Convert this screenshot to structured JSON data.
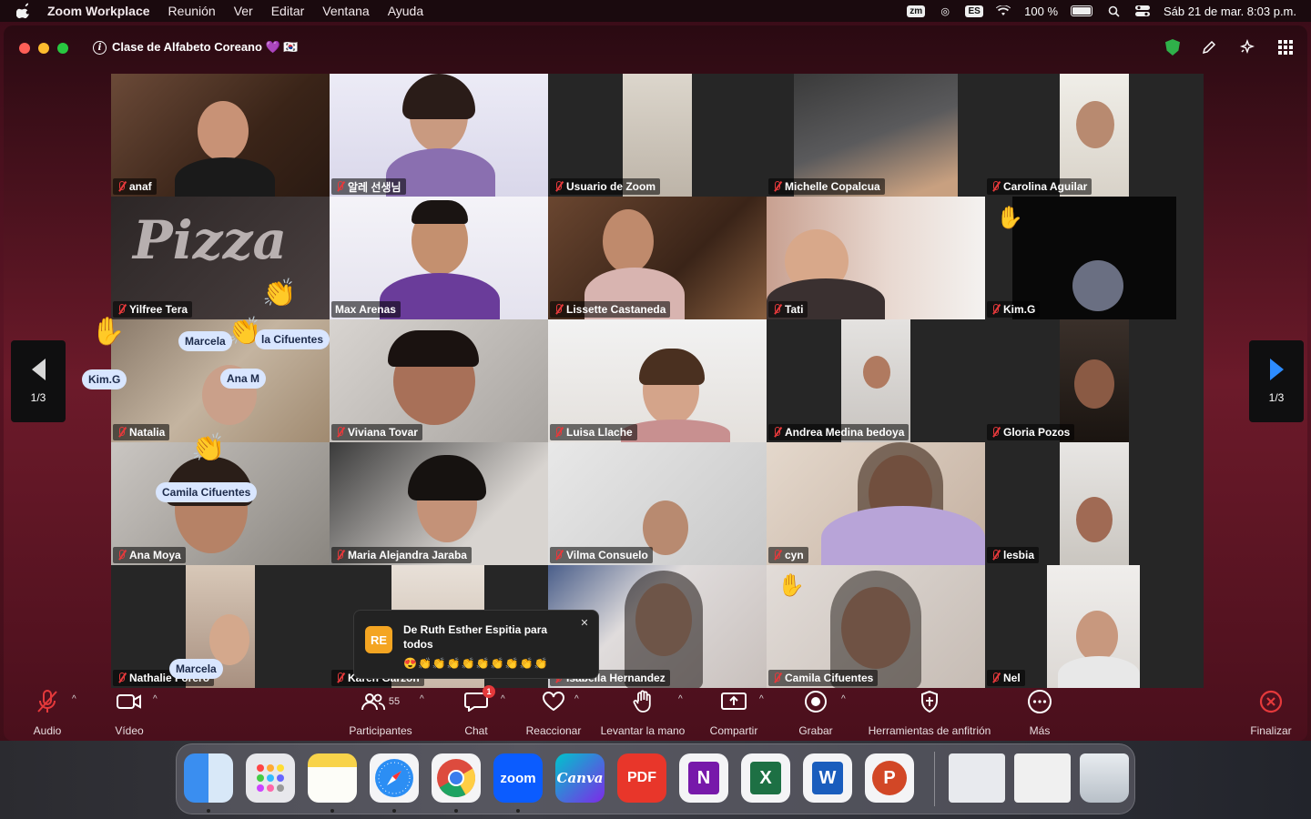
{
  "menubar": {
    "app_name": "Zoom Workplace",
    "menus": [
      "Reunión",
      "Ver",
      "Editar",
      "Ventana",
      "Ayuda"
    ],
    "input_source": "ES",
    "battery": "100 %",
    "datetime": "Sáb 21 de mar.  8:03 p.m."
  },
  "window": {
    "meeting_title": "Clase de Alfabeto Coreano 💜 🇰🇷"
  },
  "participants": [
    {
      "name": "anaf"
    },
    {
      "name": "알레 선생님"
    },
    {
      "name": "Usuario de Zoom"
    },
    {
      "name": "Michelle Copalcua"
    },
    {
      "name": "Carolina Aguilar"
    },
    {
      "name": "Yilfree Tera"
    },
    {
      "name": "Max Arenas"
    },
    {
      "name": "Lissette Castaneda"
    },
    {
      "name": "Tati"
    },
    {
      "name": "Kim.G"
    },
    {
      "name": "Natalia"
    },
    {
      "name": "Viviana Tovar"
    },
    {
      "name": "Luisa Llache"
    },
    {
      "name": "Andrea Medina bedoya"
    },
    {
      "name": "Gloria Pozos"
    },
    {
      "name": "Ana Moya"
    },
    {
      "name": "Maria Alejandra Jaraba"
    },
    {
      "name": "Vilma Consuelo"
    },
    {
      "name": "cyn"
    },
    {
      "name": "lesbia"
    },
    {
      "name": "Nathalie Forero"
    },
    {
      "name": "Karen Garzón"
    },
    {
      "name": "Isabella Hernandez"
    },
    {
      "name": "Camila Cifuentes"
    },
    {
      "name": "Nel"
    }
  ],
  "floating_labels": {
    "marcela_1": "Marcela",
    "camila_1": "la Cifuentes",
    "kimg": "Kim.G",
    "ana_m": "Ana M",
    "camila_2": "Camila Cifuentes",
    "marcela_2": "Marcela"
  },
  "pagination": {
    "left": "1/3",
    "right": "1/3"
  },
  "chat_toast": {
    "initials": "RE",
    "from": "De Ruth Esther Espitia para todos",
    "message": "😍👏👏👏👏👏👏👏👏👏"
  },
  "toolbar": {
    "audio": "Audio",
    "video": "Vídeo",
    "participants": "Participantes",
    "participants_count": "55",
    "chat": "Chat",
    "chat_badge": "1",
    "react": "Reaccionar",
    "raise_hand": "Levantar la mano",
    "share": "Compartir",
    "record": "Grabar",
    "host_tools": "Herramientas de anfitrión",
    "more": "Más",
    "end": "Finalizar"
  },
  "dock": {
    "apps": [
      "Finder",
      "Launchpad",
      "Notes",
      "Safari",
      "Chrome",
      "zoom",
      "Canva",
      "PDF",
      "OneNote",
      "Excel",
      "Word",
      "PowerPoint"
    ]
  }
}
